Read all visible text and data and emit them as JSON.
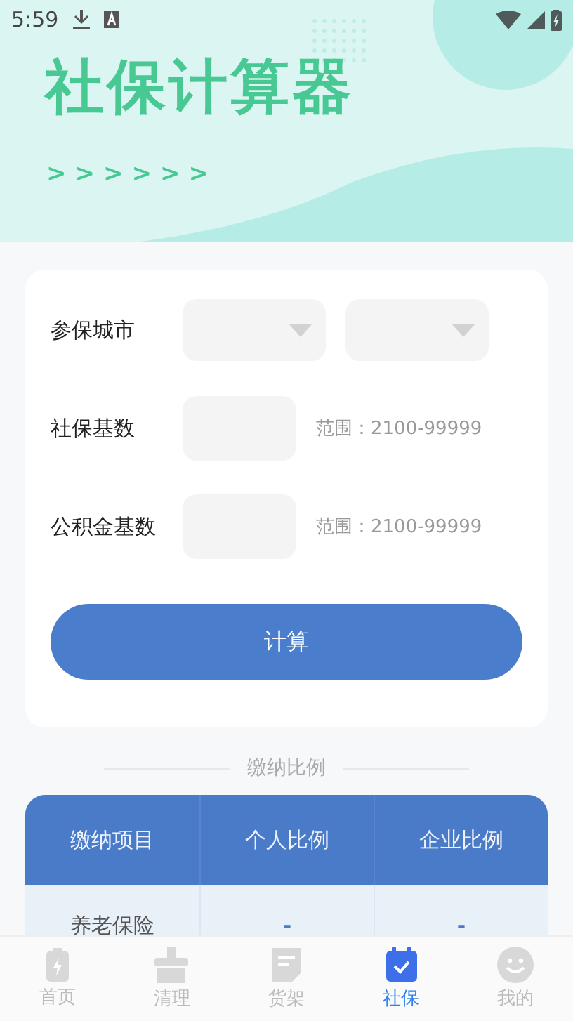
{
  "status_bar": {
    "time": "5:59"
  },
  "header": {
    "title": "社保计算器",
    "chevrons": ">>>>>>"
  },
  "form": {
    "rows": [
      {
        "kind": "city",
        "label": "参保城市"
      },
      {
        "kind": "input",
        "label": "社保基数",
        "hint": "范围：2100-99999"
      },
      {
        "kind": "input",
        "label": "公积金基数",
        "hint": "范围：2100-99999"
      }
    ],
    "button": "计算"
  },
  "ratio_section": {
    "title": "缴纳比例",
    "table": {
      "columns": [
        "缴纳项目",
        "个人比例",
        "企业比例"
      ],
      "rows": [
        [
          "养老保险",
          "-",
          "-"
        ]
      ]
    }
  },
  "bottom_nav": [
    {
      "label": "首页",
      "kind": "battery",
      "selected": false
    },
    {
      "label": "清理",
      "kind": "brush",
      "selected": false
    },
    {
      "label": "货架",
      "kind": "doc",
      "selected": false
    },
    {
      "label": "社保",
      "kind": "calendar",
      "selected": true
    },
    {
      "label": "我的",
      "kind": "smile",
      "selected": false
    }
  ]
}
